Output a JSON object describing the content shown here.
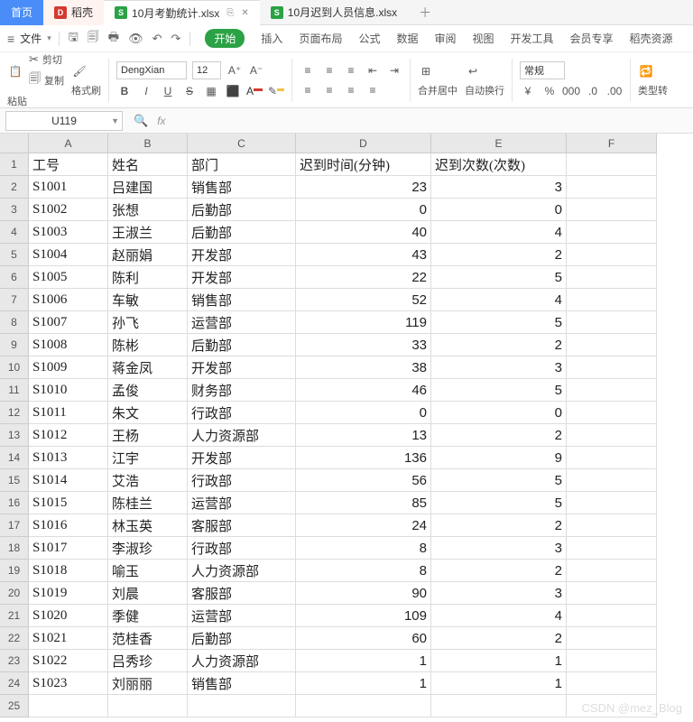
{
  "tabs": {
    "home": "首页",
    "daoke": "稻壳",
    "file1": "10月考勤统计.xlsx",
    "file2": "10月迟到人员信息.xlsx"
  },
  "toolbar": {
    "file": "文件",
    "begin": "开始",
    "insert": "插入",
    "layout": "页面布局",
    "formula": "公式",
    "data": "数据",
    "review": "审阅",
    "view": "视图",
    "dev": "开发工具",
    "member": "会员专享",
    "daoke_res": "稻壳资源"
  },
  "ribbon": {
    "cut": "剪切",
    "copy": "复制",
    "paste": "粘贴",
    "format_painter": "格式刷",
    "font_name": "DengXian",
    "font_size": "12",
    "merge": "合并居中",
    "wrap": "自动换行",
    "general": "常规",
    "type_conv": "类型转"
  },
  "cell_ref": "U119",
  "fx_label": "fx",
  "columns": [
    "A",
    "B",
    "C",
    "D",
    "E",
    "F"
  ],
  "headers": [
    "工号",
    "姓名",
    "部门",
    "迟到时间(分钟)",
    "迟到次数(次数)"
  ],
  "rows": [
    [
      "S1001",
      "吕建国",
      "销售部",
      "23",
      "3"
    ],
    [
      "S1002",
      "张想",
      "后勤部",
      "0",
      "0"
    ],
    [
      "S1003",
      "王淑兰",
      "后勤部",
      "40",
      "4"
    ],
    [
      "S1004",
      "赵丽娟",
      "开发部",
      "43",
      "2"
    ],
    [
      "S1005",
      "陈利",
      "开发部",
      "22",
      "5"
    ],
    [
      "S1006",
      "车敏",
      "销售部",
      "52",
      "4"
    ],
    [
      "S1007",
      "孙飞",
      "运营部",
      "119",
      "5"
    ],
    [
      "S1008",
      "陈彬",
      "后勤部",
      "33",
      "2"
    ],
    [
      "S1009",
      "蒋金凤",
      "开发部",
      "38",
      "3"
    ],
    [
      "S1010",
      "孟俊",
      "财务部",
      "46",
      "5"
    ],
    [
      "S1011",
      "朱文",
      "行政部",
      "0",
      "0"
    ],
    [
      "S1012",
      "王杨",
      "人力资源部",
      "13",
      "2"
    ],
    [
      "S1013",
      "江宇",
      "开发部",
      "136",
      "9"
    ],
    [
      "S1014",
      "艾浩",
      "行政部",
      "56",
      "5"
    ],
    [
      "S1015",
      "陈桂兰",
      "运营部",
      "85",
      "5"
    ],
    [
      "S1016",
      "林玉英",
      "客服部",
      "24",
      "2"
    ],
    [
      "S1017",
      "李淑珍",
      "行政部",
      "8",
      "3"
    ],
    [
      "S1018",
      "喻玉",
      "人力资源部",
      "8",
      "2"
    ],
    [
      "S1019",
      "刘晨",
      "客服部",
      "90",
      "3"
    ],
    [
      "S1020",
      "季健",
      "运营部",
      "109",
      "4"
    ],
    [
      "S1021",
      "范桂香",
      "后勤部",
      "60",
      "2"
    ],
    [
      "S1022",
      "吕秀珍",
      "人力资源部",
      "1",
      "1"
    ],
    [
      "S1023",
      "刘丽丽",
      "销售部",
      "1",
      "1"
    ]
  ],
  "watermark": "CSDN @mez_Blog"
}
